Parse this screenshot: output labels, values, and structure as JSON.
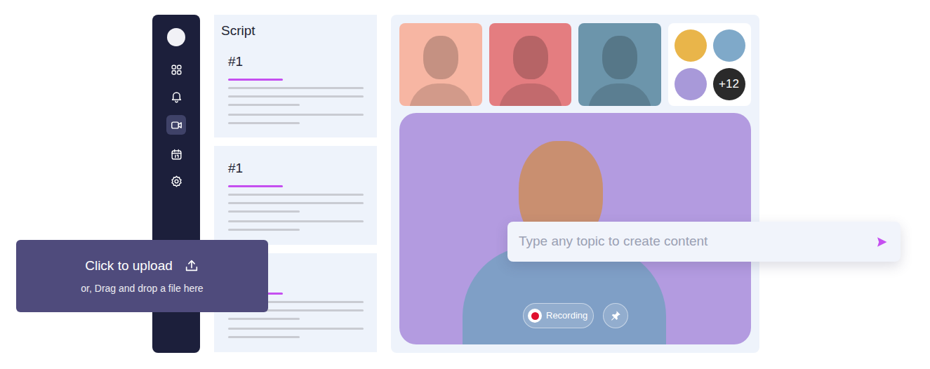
{
  "sidebar": {
    "items": [
      {
        "selected": false
      },
      {
        "selected": false
      },
      {
        "selected": true
      },
      {
        "selected": false
      },
      {
        "selected": false
      }
    ]
  },
  "script": {
    "title": "Script",
    "cards": [
      {
        "number": "#1"
      },
      {
        "number": "#1"
      },
      {}
    ]
  },
  "avatars": {
    "overflow": "+12"
  },
  "video": {
    "recording": "Recording"
  },
  "prompt": {
    "placeholder": "Type any topic to create content"
  },
  "upload": {
    "title": "Click to upload",
    "subtitle": "or, Drag and drop a file here"
  }
}
